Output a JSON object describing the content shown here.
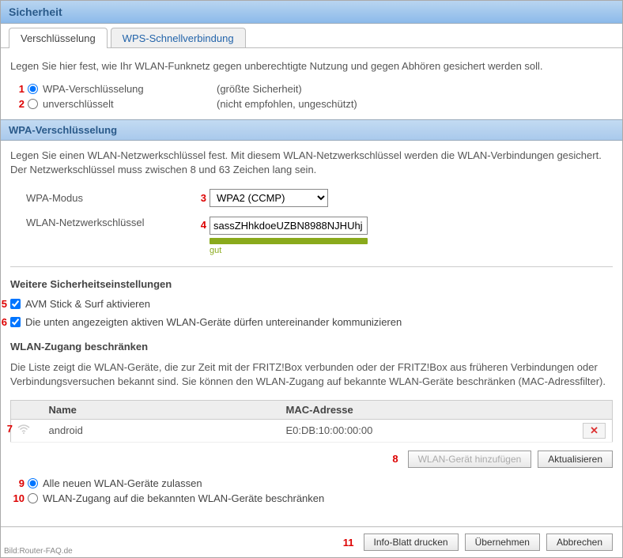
{
  "header": {
    "title": "Sicherheit"
  },
  "tabs": {
    "active": "Verschlüsselung",
    "other": "WPS-Schnellverbindung"
  },
  "intro": "Legen Sie hier fest, wie Ihr WLAN-Funknetz gegen unberechtigte Nutzung und gegen Abhören gesichert werden soll.",
  "markers": {
    "m1": "1",
    "m2": "2",
    "m3": "3",
    "m4": "4",
    "m5": "5",
    "m6": "6",
    "m7": "7",
    "m8": "8",
    "m9": "9",
    "m10": "10",
    "m11": "11"
  },
  "enc": {
    "wpa_label": "WPA-Verschlüsselung",
    "wpa_note": "(größte Sicherheit)",
    "none_label": "unverschlüsselt",
    "none_note": "(nicht empfohlen, ungeschützt)"
  },
  "wpa_section": {
    "title": "WPA-Verschlüsselung",
    "desc": "Legen Sie einen WLAN-Netzwerkschlüssel fest. Mit diesem WLAN-Netzwerkschlüssel werden die WLAN-Verbindungen gesichert. Der Netzwerkschlüssel muss zwischen 8 und 63 Zeichen lang sein.",
    "mode_label": "WPA-Modus",
    "mode_value": "WPA2 (CCMP)",
    "key_label": "WLAN-Netzwerkschlüssel",
    "key_value": "sassZHhkdoeUZBN8988NJHUhj",
    "strength": "gut"
  },
  "further": {
    "title": "Weitere Sicherheitseinstellungen",
    "avm": "AVM Stick & Surf aktivieren",
    "comm": "Die unten angezeigten aktiven WLAN-Geräte dürfen untereinander kommunizieren"
  },
  "restrict": {
    "title": "WLAN-Zugang beschränken",
    "desc": "Die Liste zeigt die WLAN-Geräte, die zur Zeit mit der FRITZ!Box verbunden oder der FRITZ!Box aus früheren Verbindungen oder Verbindungsversuchen bekannt sind. Sie können den WLAN-Zugang auf bekannte WLAN-Geräte beschränken (MAC-Adressfilter).",
    "col_name": "Name",
    "col_mac": "MAC-Adresse",
    "row_name": "android",
    "row_mac": "E0:DB:10:00:00:00",
    "delete": "✕",
    "add": "WLAN-Gerät hinzufügen",
    "refresh": "Aktualisieren",
    "allow_all": "Alle neuen WLAN-Geräte zulassen",
    "restrict_known": "WLAN-Zugang auf die bekannten WLAN-Geräte beschränken"
  },
  "footer": {
    "print": "Info-Blatt drucken",
    "apply": "Übernehmen",
    "cancel": "Abbrechen",
    "credit": "Bild:Router-FAQ.de"
  }
}
